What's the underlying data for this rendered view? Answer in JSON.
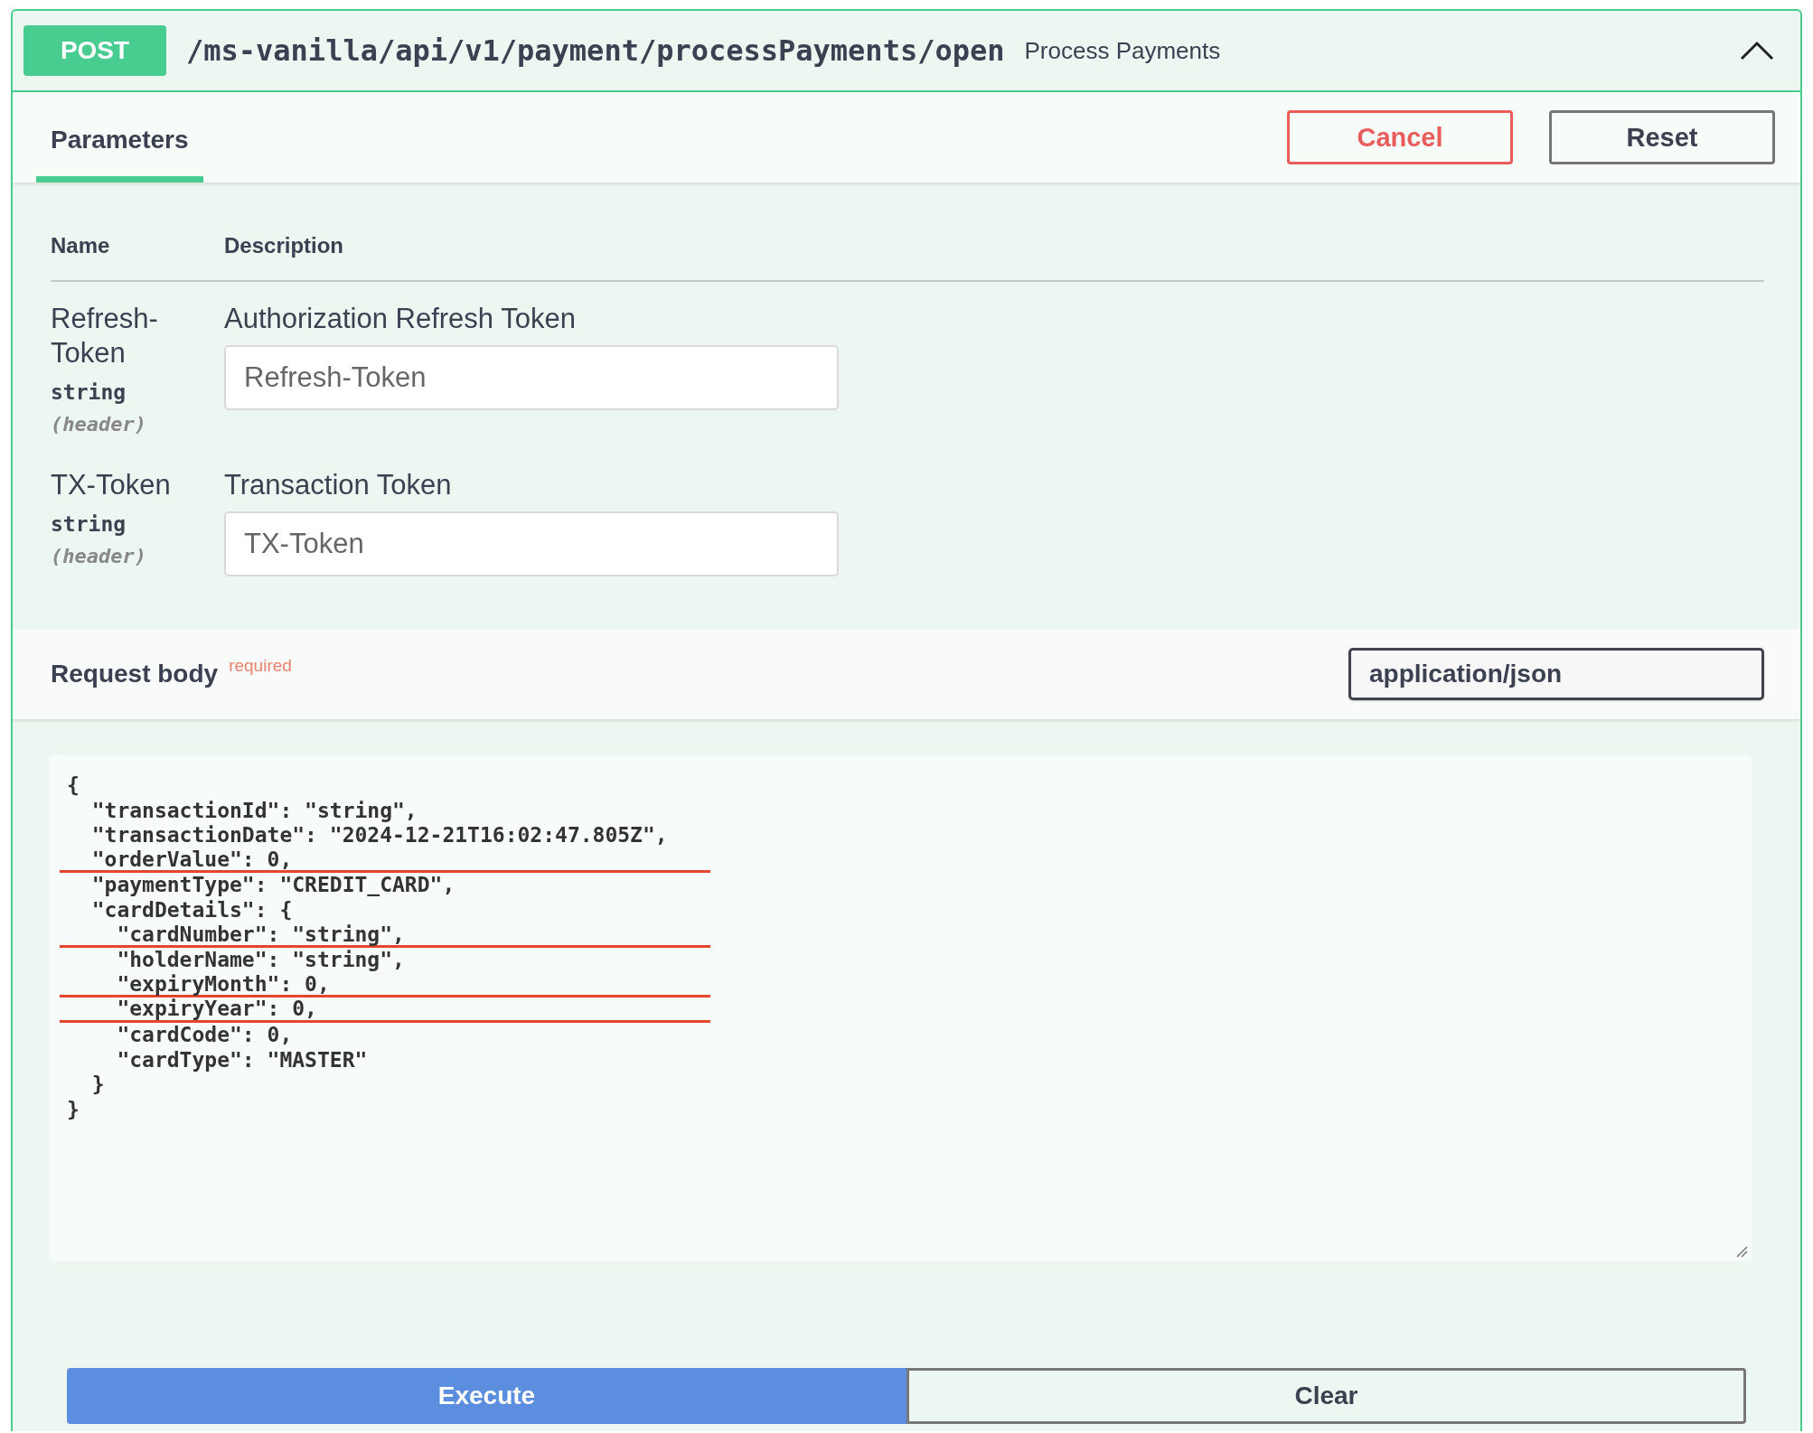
{
  "operation": {
    "method": "POST",
    "path": "/ms-vanilla/api/v1/payment/processPayments/open",
    "summary": "Process Payments",
    "expanded": true
  },
  "tabs": [
    {
      "label": "Parameters",
      "selected": true
    }
  ],
  "actions": [
    {
      "label": "Cancel",
      "kind": "cancel"
    },
    {
      "label": "Reset",
      "kind": "reset"
    }
  ],
  "parameters": {
    "columns": [
      "Name",
      "Description"
    ],
    "rows": [
      {
        "name": "Refresh-Token",
        "type": "string",
        "location": "(header)",
        "description": "Authorization Refresh Token",
        "placeholder": "Refresh-Token"
      },
      {
        "name": "TX-Token",
        "type": "string",
        "location": "(header)",
        "description": "Transaction Token",
        "placeholder": "TX-Token"
      }
    ]
  },
  "request_body": {
    "title": "Request body",
    "required_label": "required",
    "content_type": "application/json",
    "lines": [
      {
        "text": "{",
        "marked": false
      },
      {
        "text": "  \"transactionId\": \"string\",",
        "marked": false
      },
      {
        "text": "  \"transactionDate\": \"2024-12-21T16:02:47.805Z\",",
        "marked": false
      },
      {
        "text": "  \"orderValue\": 0,",
        "marked": true
      },
      {
        "text": "  \"paymentType\": \"CREDIT_CARD\",",
        "marked": false
      },
      {
        "text": "  \"cardDetails\": {",
        "marked": false
      },
      {
        "text": "    \"cardNumber\": \"string\",",
        "marked": true
      },
      {
        "text": "    \"holderName\": \"string\",",
        "marked": false
      },
      {
        "text": "    \"expiryMonth\": 0,",
        "marked": true
      },
      {
        "text": "    \"expiryYear\": 0,",
        "marked": true
      },
      {
        "text": "    \"cardCode\": 0,",
        "marked": false
      },
      {
        "text": "    \"cardType\": \"MASTER\"",
        "marked": false
      },
      {
        "text": "  }",
        "marked": false
      },
      {
        "text": "}",
        "marked": false
      }
    ]
  },
  "buttons": [
    {
      "label": "Execute",
      "kind": "primary"
    },
    {
      "label": "Clear",
      "kind": "secondary"
    }
  ]
}
